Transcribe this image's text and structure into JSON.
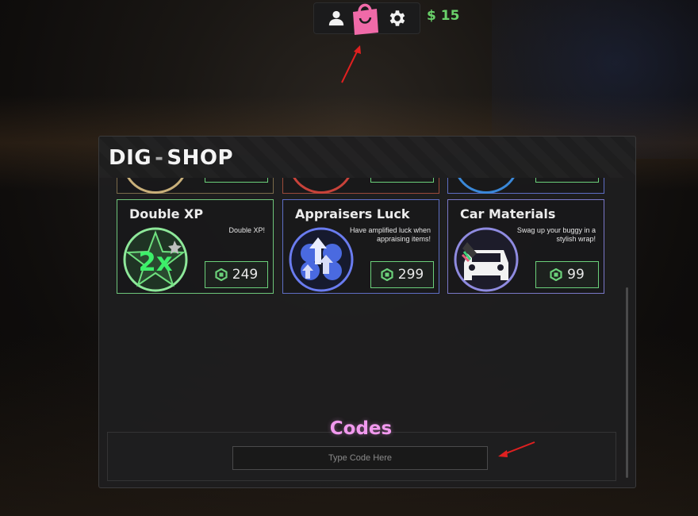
{
  "topbar": {
    "money": "$ 15",
    "profile_icon": "person-icon",
    "shop_icon": "shopping-bag-icon",
    "settings_icon": "gear-icon"
  },
  "shop": {
    "title_brand": "DIG",
    "title_separator": "-",
    "title_label": "SHOP",
    "items": [
      {
        "title": "Double XP",
        "description": "Double XP!",
        "price": "249",
        "icon": "double-xp-star-icon",
        "accent": "#6ec57a"
      },
      {
        "title": "Appraisers Luck",
        "description": "Have amplified luck when appraising items!",
        "price": "299",
        "icon": "clover-arrows-icon",
        "accent": "#5e6ec4"
      },
      {
        "title": "Car Materials",
        "description": "Swag up your buggy in a stylish wrap!",
        "price": "99",
        "icon": "car-paint-icon",
        "accent": "#7a78c8"
      }
    ],
    "codes": {
      "title": "Codes",
      "placeholder": "Type Code Here"
    }
  },
  "colors": {
    "money": "#6ad16a",
    "price_border": "#6bd07a",
    "codes_title": "#f199ee",
    "shop_icon": "#f06aa8"
  }
}
